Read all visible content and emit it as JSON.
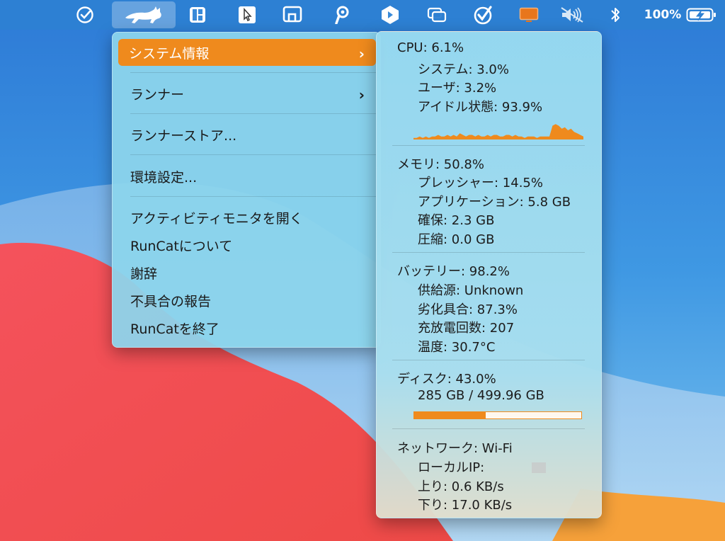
{
  "menubar": {
    "icons": [
      "checkmark-circle-icon",
      "runcat-icon",
      "windows-grid-icon",
      "cursor-icon",
      "display-icon",
      "p-icon",
      "shortcuts-icon",
      "windows-icon",
      "check-badge-icon",
      "screen-icon",
      "speaker-muted-icon",
      "bluetooth-icon"
    ],
    "battery_percent": "100%"
  },
  "main_menu": {
    "items": [
      {
        "label": "システム情報",
        "submenu": true
      },
      {
        "label": "ランナー",
        "submenu": true
      },
      {
        "label": "ランナーストア..."
      },
      {
        "label": "環境設定..."
      },
      {
        "label": "アクティビティモニタを開く"
      },
      {
        "label": "RunCatについて"
      },
      {
        "label": "謝辞"
      },
      {
        "label": "不具合の報告"
      },
      {
        "label": "RunCatを終了"
      }
    ],
    "chevron": "›"
  },
  "system_info": {
    "cpu": {
      "title": "CPU:  6.1%",
      "system": "システム:  3.0%",
      "user": "ユーザ:  3.2%",
      "idle": "アイドル状態: 93.9%",
      "history": [
        1,
        1,
        2,
        1,
        2,
        1,
        2,
        2,
        3,
        2,
        2,
        3,
        2,
        3,
        2,
        4,
        3,
        2,
        3,
        3,
        2,
        3,
        2,
        2,
        3,
        2,
        3,
        3,
        2,
        2,
        3,
        3,
        2,
        3,
        2,
        2,
        1,
        2,
        2,
        2,
        1,
        2,
        2,
        2,
        2,
        9,
        10,
        9,
        7,
        8,
        6,
        7,
        5,
        4,
        3,
        2
      ]
    },
    "memory": {
      "title": "メモリ: 50.8%",
      "pressure": "プレッシャー: 14.5%",
      "app": "アプリケーション:  5.8 GB",
      "wired": "確保:  2.3 GB",
      "compressed": "圧縮:  0.0 GB"
    },
    "battery": {
      "title": "バッテリー:  98.2%",
      "source": "供給源: Unknown",
      "health": "劣化具合:  87.3%",
      "cycles": "充放電回数: 207",
      "temp": "温度: 30.7°C"
    },
    "disk": {
      "title": "ディスク: 43.0%",
      "usage": "285 GB / 499.96 GB",
      "fraction": 0.43
    },
    "network": {
      "title": "ネットワーク: Wi-Fi",
      "local_ip": "ローカルIP:",
      "up": "上り:    0.6 KB/s",
      "down": "下り:  17.0 KB/s"
    }
  },
  "colors": {
    "accent": "#ef8a1d"
  }
}
